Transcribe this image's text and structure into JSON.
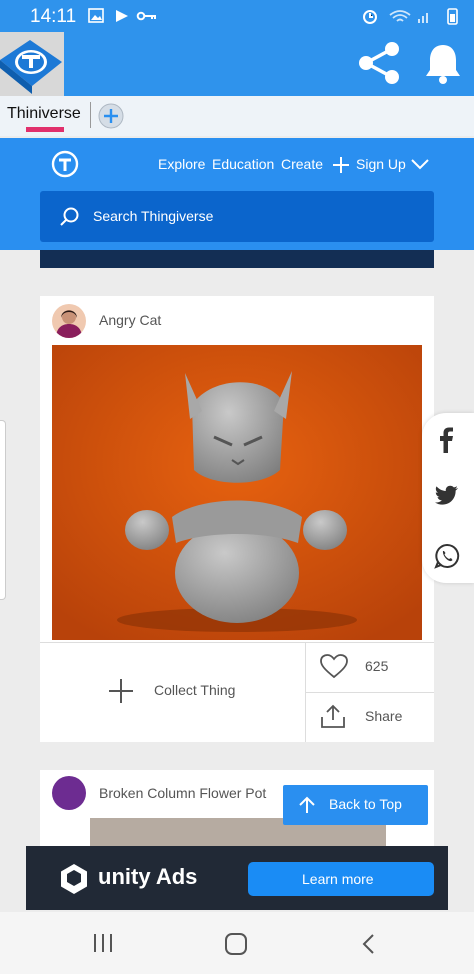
{
  "status": {
    "time": "14:11"
  },
  "browser": {
    "tab_label": "Thiniverse"
  },
  "site": {
    "nav": [
      "Explore",
      "Education",
      "Create",
      "Sign Up"
    ],
    "search_placeholder": "Search Thingiverse"
  },
  "cards": [
    {
      "author_name": "Angry Cat",
      "likes": "625",
      "collect_label": "Collect Thing",
      "share_label": "Share"
    },
    {
      "author_name": "Broken Column Flower Pot"
    }
  ],
  "back_to_top": "Back to Top",
  "ad": {
    "brand": "unity Ads",
    "cta": "Learn more"
  },
  "colors": {
    "brand_blue": "#2a8ff0",
    "ad_bg": "#212936"
  }
}
